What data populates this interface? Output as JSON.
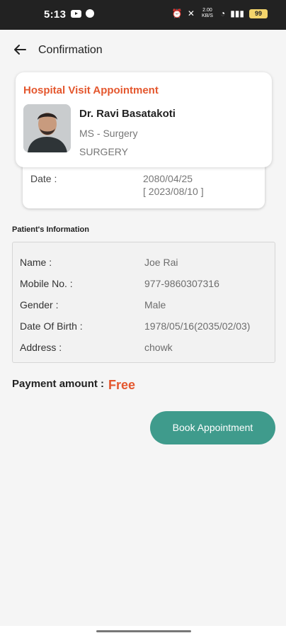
{
  "status_bar": {
    "time": "5:13",
    "net_speed": "2.00 KB/S",
    "battery": "99"
  },
  "app_bar": {
    "title": "Confirmation",
    "back_icon": "arrow-left-icon"
  },
  "appointment": {
    "heading": "Hospital Visit Appointment",
    "doctor_name": "Dr. Ravi Basatakoti",
    "degree": "MS - Surgery",
    "department": "SURGERY",
    "date_label": "Date :",
    "date_bs": "2080/04/25",
    "date_ad": "[ 2023/08/10 ]"
  },
  "patient": {
    "section_title": "Patient's Information",
    "rows": [
      {
        "label": "Name :",
        "value": "Joe Rai"
      },
      {
        "label": "Mobile No. :",
        "value": "977-9860307316"
      },
      {
        "label": "Gender :",
        "value": "Male"
      },
      {
        "label": "Date Of Birth :",
        "value": "1978/05/16(2035/02/03)"
      },
      {
        "label": "Address :",
        "value": "chowk"
      }
    ]
  },
  "payment": {
    "label": "Payment amount :",
    "value": "Free"
  },
  "actions": {
    "book_label": "Book Appointment"
  },
  "colors": {
    "accent_orange": "#e4572e",
    "button_teal": "#3f9b8c"
  }
}
